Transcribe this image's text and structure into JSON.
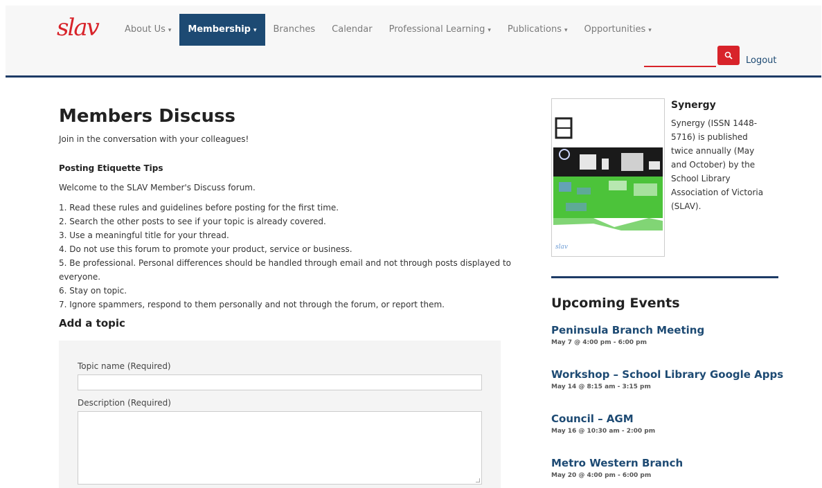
{
  "header": {
    "logo_text": "slav",
    "nav": [
      {
        "label": "About Us",
        "dropdown": true
      },
      {
        "label": "Membership",
        "dropdown": true,
        "active": true
      },
      {
        "label": "Branches",
        "dropdown": false
      },
      {
        "label": "Calendar",
        "dropdown": false
      },
      {
        "label": "Professional Learning",
        "dropdown": true
      },
      {
        "label": "Publications",
        "dropdown": true
      },
      {
        "label": "Opportunities",
        "dropdown": true
      }
    ],
    "caret": "▾",
    "logout_label": "Logout",
    "search_icon": "search-icon"
  },
  "main": {
    "title": "Members Discuss",
    "intro": "Join in the conversation with your colleagues!",
    "tips_heading": "Posting Etiquette Tips",
    "welcome": "Welcome to the SLAV Member's Discuss forum.",
    "rules": [
      "1. Read these rules and guidelines before posting for the first time.",
      "2. Search the other posts to see if your topic is already covered.",
      "3. Use a meaningful title for your thread.",
      "4. Do not use this forum to promote your product, service or business.",
      "5. Be professional. Personal differences should be handled through email and not through posts displayed to everyone.",
      "6. Stay on topic.",
      "7. Ignore spammers, respond to them personally and not through the forum, or report them."
    ],
    "add_topic_heading": "Add a topic",
    "form": {
      "topic_label": "Topic name (Required)",
      "topic_value": "",
      "description_label": "Description (Required)",
      "description_value": ""
    }
  },
  "sidebar": {
    "synergy_title": "Synergy",
    "synergy_text": "Synergy (ISSN 1448-5716) is published twice annually (May and October) by the School Library Association of Victoria (SLAV).",
    "cover_label": "slav",
    "events_heading": "Upcoming Events",
    "events": [
      {
        "title": "Peninsula Branch Meeting",
        "date": "May 7 @ 4:00 pm - 6:00 pm"
      },
      {
        "title": "Workshop – School Library Google Apps",
        "date": "May 14 @ 8:15 am - 3:15 pm"
      },
      {
        "title": "Council – AGM",
        "date": "May 16 @ 10:30 am - 2:00 pm"
      },
      {
        "title": "Metro Western Branch",
        "date": "May 20 @ 4:00 pm - 6:00 pm"
      }
    ]
  },
  "colors": {
    "brand_red": "#d8232a",
    "brand_navy": "#1d4a73",
    "divider_navy": "#1d3b66",
    "cover_green": "#4cc33a"
  }
}
